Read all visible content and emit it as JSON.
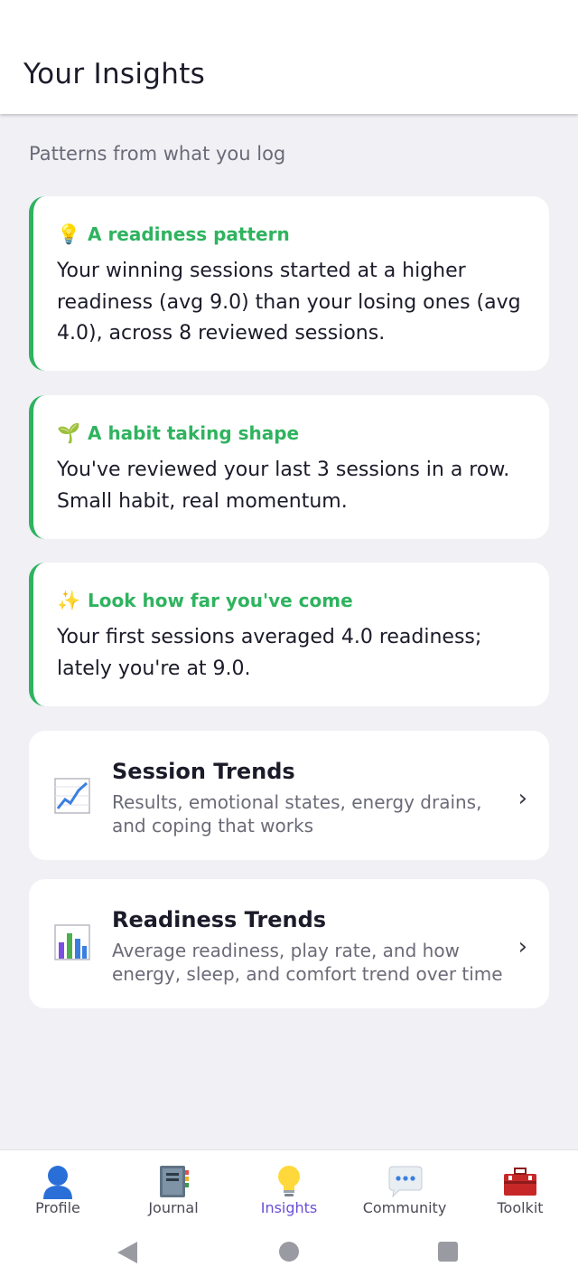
{
  "header": {
    "title": "Your Insights"
  },
  "subtitle": "Patterns from what you log",
  "insights": [
    {
      "icon": "lightbulb-icon",
      "emoji": "💡",
      "title": "A readiness pattern",
      "body": "Your winning sessions started at a higher readiness (avg 9.0) than your losing ones (avg 4.0), across 8 reviewed sessions."
    },
    {
      "icon": "seedling-icon",
      "emoji": "🌱",
      "title": "A habit taking shape",
      "body": "You've reviewed your last 3 sessions in a row. Small habit, real momentum."
    },
    {
      "icon": "sparkles-icon",
      "emoji": "✨",
      "title": "Look how far you've come",
      "body": "Your first sessions averaged 4.0 readiness; lately you're at 9.0."
    }
  ],
  "links": [
    {
      "icon": "line-chart-icon",
      "title": "Session Trends",
      "description": "Results, emotional states, energy drains, and coping that works"
    },
    {
      "icon": "bar-chart-icon",
      "title": "Readiness Trends",
      "description": "Average readiness, play rate, and how energy, sleep, and comfort trend over time"
    }
  ],
  "tabs": [
    {
      "label": "Profile",
      "icon": "person-icon"
    },
    {
      "label": "Journal",
      "icon": "notebook-icon"
    },
    {
      "label": "Insights",
      "icon": "lightbulb-icon",
      "active": true
    },
    {
      "label": "Community",
      "icon": "speech-bubble-icon"
    },
    {
      "label": "Toolkit",
      "icon": "toolbox-icon"
    }
  ],
  "colors": {
    "accent_green": "#2fb35f",
    "active_tab": "#6a4fd8",
    "background": "#f0f0f5"
  }
}
